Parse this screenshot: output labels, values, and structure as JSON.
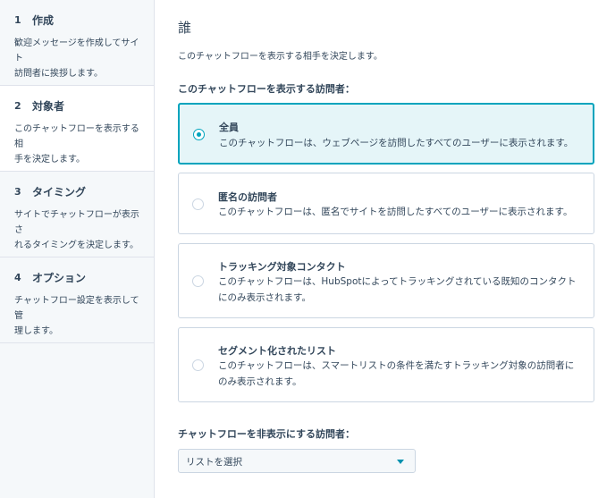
{
  "steps": [
    {
      "number": "1",
      "title": "作成",
      "desc_line1": "歓迎メッセージを作成してサイト",
      "desc_line2": "訪問者に挨拶します。"
    },
    {
      "number": "2",
      "title": "対象者",
      "desc_line1": "このチャットフローを表示する相",
      "desc_line2": "手を決定します。"
    },
    {
      "number": "3",
      "title": "タイミング",
      "desc_line1": "サイトでチャットフローが表示さ",
      "desc_line2": "れるタイミングを決定します。"
    },
    {
      "number": "4",
      "title": "オプション",
      "desc_line1": "チャットフロー設定を表示して管",
      "desc_line2": "理します。"
    }
  ],
  "main": {
    "title": "誰",
    "subtitle": "このチャットフローを表示する相手を決定します。",
    "show_label": "このチャットフローを表示する訪問者：",
    "hide_label": "チャットフローを非表示にする訪問者：",
    "options": [
      {
        "title": "全員",
        "desc": "このチャットフローは、ウェブページを訪問したすべてのユーザーに表示されます。",
        "selected": true
      },
      {
        "title": "匿名の訪問者",
        "desc": "このチャットフローは、匿名でサイトを訪問したすべてのユーザーに表示されます。",
        "selected": false
      },
      {
        "title": "トラッキング対象コンタクト",
        "desc": "このチャットフローは、HubSpotによってトラッキングされている既知のコンタクトにのみ表示されます。",
        "selected": false
      },
      {
        "title": "セグメント化されたリスト",
        "desc": "このチャットフローは、スマートリストの条件を満たすトラッキング対象の訪問者にのみ表示されます。",
        "selected": false
      }
    ],
    "list_select": {
      "value": "リストを選択"
    }
  },
  "colors": {
    "accent": "#00a4bd",
    "selected_bg": "#e5f5f8",
    "text": "#33475b",
    "sidebar_bg": "#f5f8fa"
  }
}
